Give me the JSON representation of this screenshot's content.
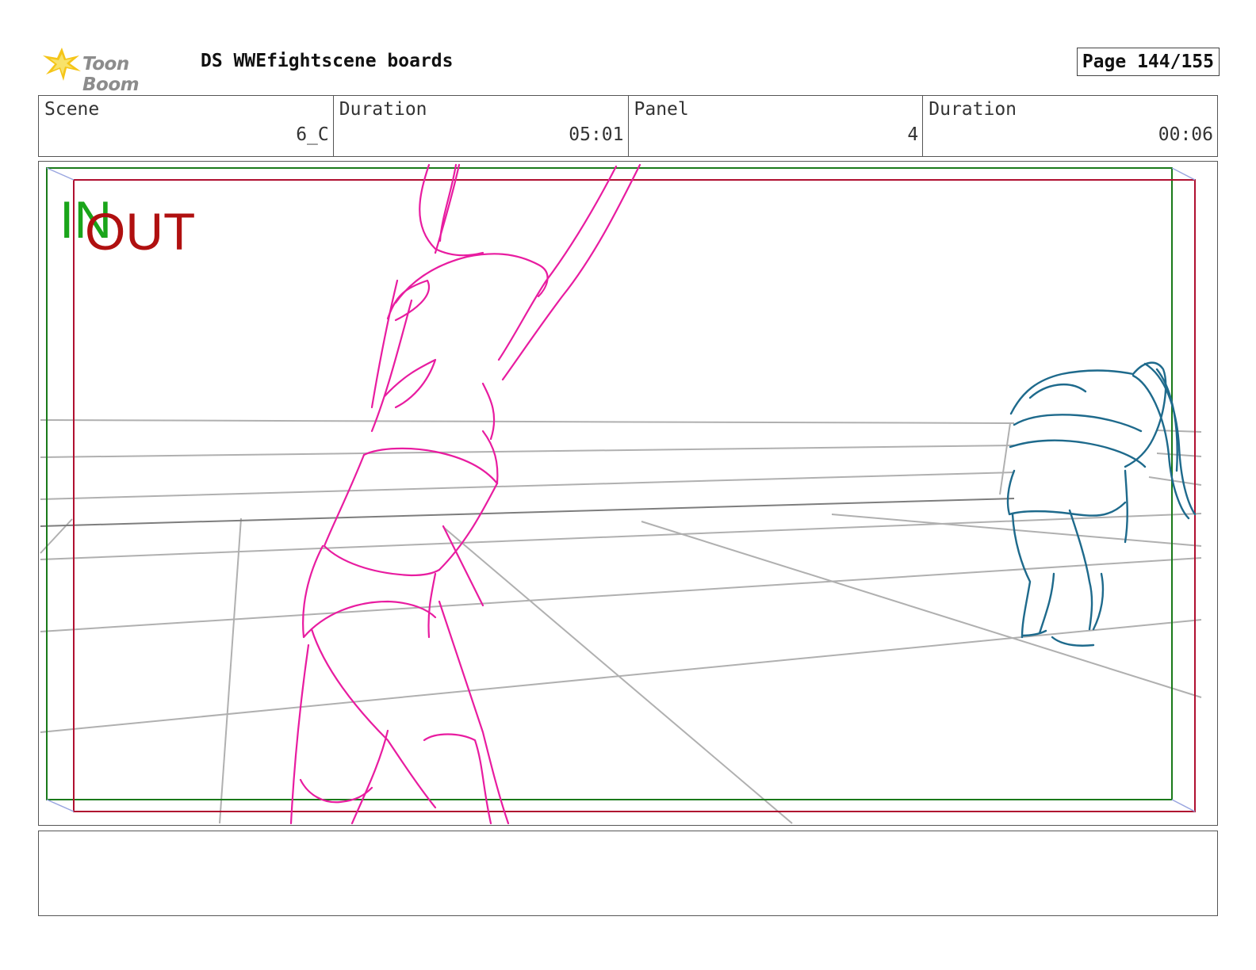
{
  "header": {
    "logo_text": "Toon Boom",
    "title": "DS WWEfightscene boards",
    "page": "Page 144/155"
  },
  "info": {
    "scene_label": "Scene",
    "scene_value": "6_C",
    "scene_duration_label": "Duration",
    "scene_duration_value": "05:01",
    "panel_label": "Panel",
    "panel_value": "4",
    "panel_duration_label": "Duration",
    "panel_duration_value": "00:06"
  },
  "frame": {
    "in_label": "IN",
    "out_label": "OUT",
    "in_color": "#1aa51a",
    "out_color": "#b01010"
  },
  "sketch": {
    "foreground_color": "#e81ca0",
    "background_figure_color": "#1e6a8c",
    "guide_color": "#b0b0b0"
  },
  "notes": {
    "text": ""
  }
}
